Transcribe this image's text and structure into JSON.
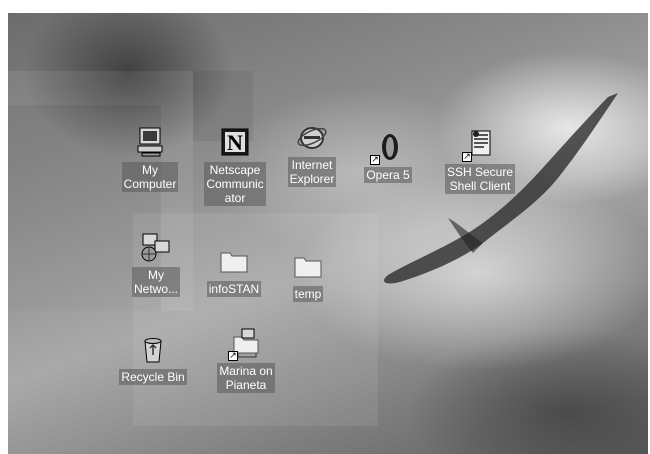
{
  "desktop": {
    "icons": [
      {
        "label": "My\nComputer",
        "icon": "my-computer-icon"
      },
      {
        "label": "Netscape\nCommunic\nator",
        "icon": "netscape-icon"
      },
      {
        "label": "Internet\nExplorer",
        "icon": "internet-explorer-icon"
      },
      {
        "label": "Opera 5",
        "icon": "opera-icon"
      },
      {
        "label": "SSH Secure\nShell Client",
        "icon": "ssh-client-icon"
      },
      {
        "label": "My\nNetwo...",
        "icon": "network-icon"
      },
      {
        "label": "infoSTAN",
        "icon": "folder-icon"
      },
      {
        "label": "temp",
        "icon": "folder-icon"
      },
      {
        "label": "Recycle Bin",
        "icon": "recycle-bin-icon"
      },
      {
        "label": "Marina on\nPianeta",
        "icon": "network-share-icon"
      }
    ]
  }
}
